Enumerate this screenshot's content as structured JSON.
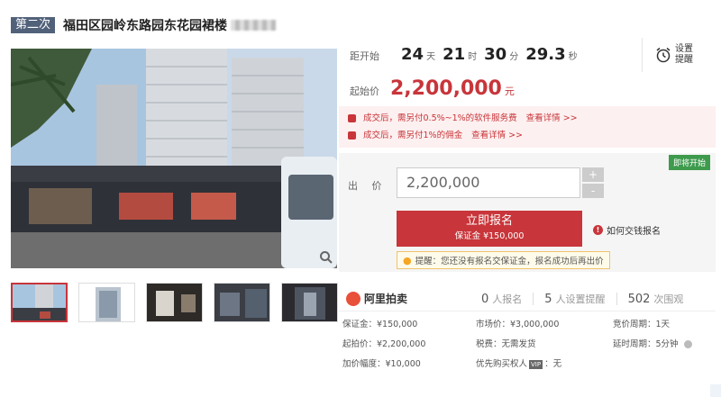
{
  "title": {
    "round": "第二次",
    "name": "福田区园岭东路园东花园裙楼"
  },
  "countdown": {
    "label": "距开始",
    "days": "24",
    "days_unit": "天",
    "hours": "21",
    "hours_unit": "时",
    "minutes": "30",
    "minutes_unit": "分",
    "seconds": "29.3",
    "seconds_unit": "秒"
  },
  "start_price": {
    "label": "起始价",
    "value": "2,200,000",
    "unit": "元"
  },
  "reminder": {
    "label": "设置提醒",
    "icon": "alarm-clock-icon"
  },
  "fees": [
    {
      "text": "成交后，需另付0.5%~1%的软件服务费",
      "link": "查看详情 >>"
    },
    {
      "text": "成交后，需另付1%的佣金",
      "link": "查看详情 >>"
    }
  ],
  "bid": {
    "tag": "即将开始",
    "label": "出 价",
    "value": "2,200,000",
    "plus": "+",
    "minus": "-",
    "apply_main": "立即报名",
    "apply_sub": "保证金 ¥150,000",
    "how_link": "如何交钱报名",
    "tip": "提醒：您还没有报名交保证金，报名成功后再出价"
  },
  "stats": {
    "brand": "阿里拍卖",
    "registrants_num": "0",
    "registrants_label": "人报名",
    "reminders_num": "5",
    "reminders_label": "人设置提醒",
    "views_num": "502",
    "views_label": "次围观"
  },
  "details": {
    "deposit": "保证金：¥150,000",
    "market_price": "市场价：¥3,000,000",
    "period": "竞价周期：1天",
    "start": "起拍价：¥2,200,000",
    "taxes": "税费：无需发货",
    "delay": "延时周期：5分钟",
    "increment": "加价幅度：¥10,000",
    "priority_prefix": "优先购买权人",
    "priority_badge": "VIP",
    "priority_suffix": "：无"
  },
  "colors": {
    "accent": "#c8353a",
    "round_tag": "#51617a",
    "now_tag": "#3e9b4d"
  }
}
